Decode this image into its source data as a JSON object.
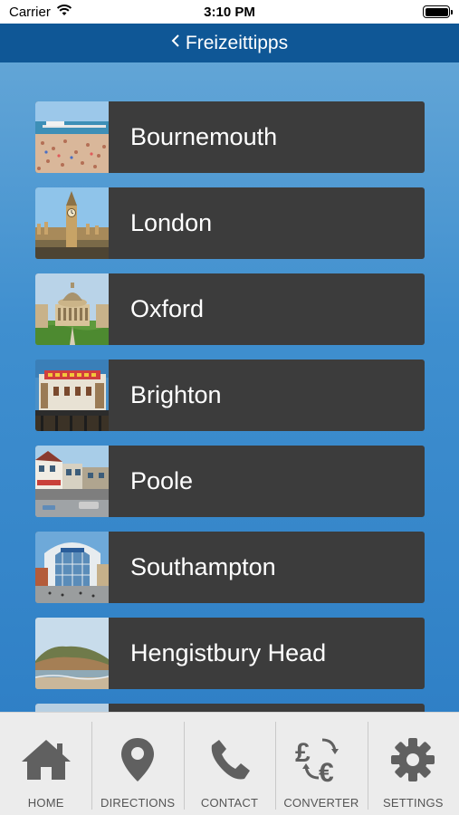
{
  "status_bar": {
    "carrier": "Carrier",
    "time": "3:10 PM",
    "battery_level": 1.0
  },
  "nav": {
    "back_icon": "chevron-left-icon",
    "title": "Freizeittipps"
  },
  "places": [
    {
      "label": "Bournemouth",
      "thumb": "beach-pier"
    },
    {
      "label": "London",
      "thumb": "big-ben"
    },
    {
      "label": "Oxford",
      "thumb": "radcliffe-camera"
    },
    {
      "label": "Brighton",
      "thumb": "brighton-pier"
    },
    {
      "label": "Poole",
      "thumb": "harbour-street"
    },
    {
      "label": "Southampton",
      "thumb": "shopping-centre"
    },
    {
      "label": "Hengistbury Head",
      "thumb": "coastal-cliff"
    }
  ],
  "tabs": [
    {
      "label": "HOME",
      "icon": "home-icon"
    },
    {
      "label": "DIRECTIONS",
      "icon": "map-pin-icon"
    },
    {
      "label": "CONTACT",
      "icon": "phone-icon"
    },
    {
      "label": "CONVERTER",
      "icon": "currency-exchange-icon"
    },
    {
      "label": "SETTINGS",
      "icon": "gear-icon"
    }
  ],
  "colors": {
    "nav_bar": "#0f5796",
    "list_item": "#3c3c3c",
    "tab_icon": "#606060",
    "background_top": "#6aaad8",
    "background_bottom": "#2b7cc4"
  }
}
